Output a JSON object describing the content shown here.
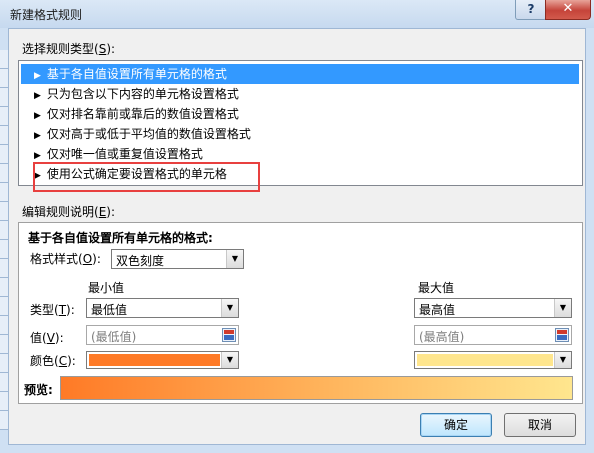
{
  "window": {
    "title": "新建格式规则",
    "help_label": "?",
    "close_label": "✕"
  },
  "rule_type": {
    "label": "选择规则类型(",
    "key": "S",
    "label_end": "):",
    "items": [
      {
        "label": "基于各自值设置所有单元格的格式",
        "selected": true
      },
      {
        "label": "只为包含以下内容的单元格设置格式",
        "selected": false
      },
      {
        "label": "仅对排名靠前或靠后的数值设置格式",
        "selected": false
      },
      {
        "label": "仅对高于或低于平均值的数值设置格式",
        "selected": false
      },
      {
        "label": "仅对唯一值或重复值设置格式",
        "selected": false
      },
      {
        "label": "使用公式确定要设置格式的单元格",
        "selected": false
      }
    ]
  },
  "description": {
    "label": "编辑规则说明(",
    "key": "E",
    "label_end": "):",
    "heading": "基于各自值设置所有单元格的格式:",
    "format_style_label": "格式样式(",
    "format_style_key": "O",
    "format_style_end": "):",
    "format_style_value": "双色刻度",
    "min_header": "最小值",
    "max_header": "最大值",
    "type_label": "类型(",
    "type_key": "T",
    "type_end": "):",
    "min_type": "最低值",
    "max_type": "最高值",
    "value_label": "值(",
    "value_key": "V",
    "value_end": "):",
    "min_value_placeholder": "(最低值)",
    "max_value_placeholder": "(最高值)",
    "color_label": "颜色(",
    "color_key": "C",
    "color_end": "):",
    "min_color": "#ff7a26",
    "max_color": "#ffe68e",
    "preview_label": "预览:"
  },
  "buttons": {
    "ok": "确定",
    "cancel": "取消"
  }
}
